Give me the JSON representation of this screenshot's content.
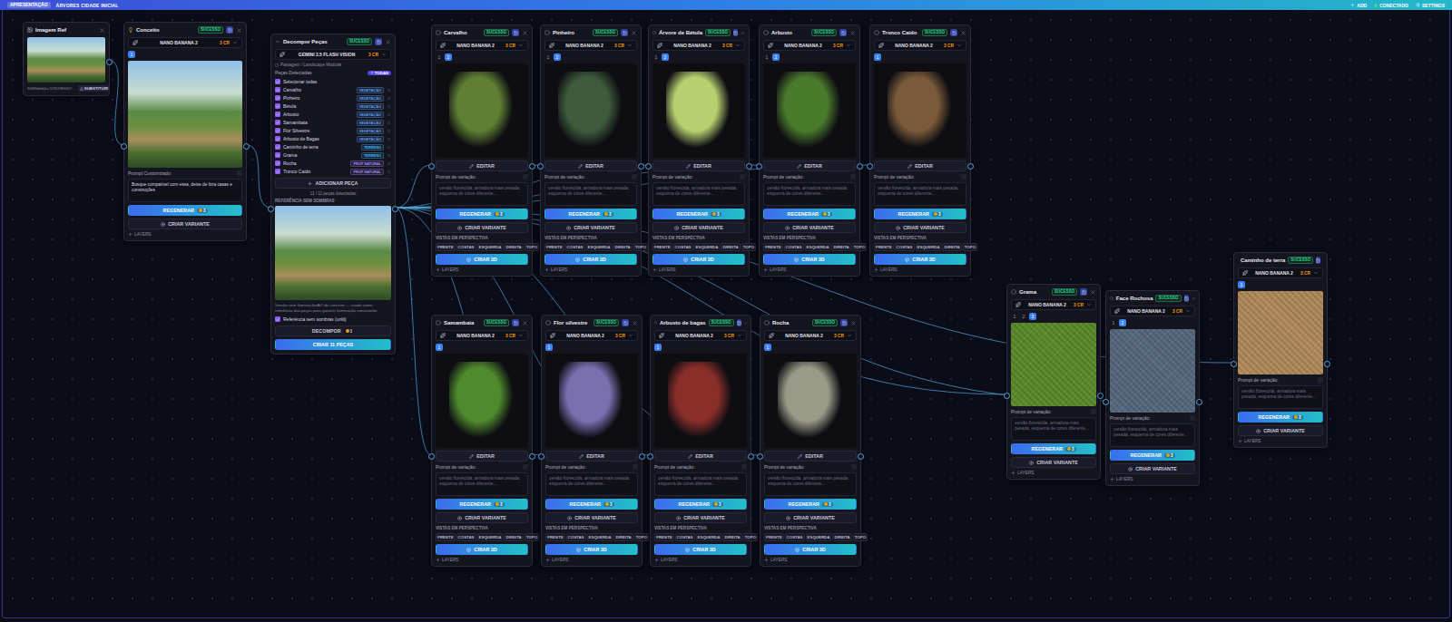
{
  "topbar": {
    "badge": "APRESENTAÇÃO",
    "title": "ÁRVORES CIDADE INICIAL",
    "actions": [
      "ADD",
      "CONECTADO",
      "SETTINGS"
    ]
  },
  "ref": {
    "title": "Imagem Ref",
    "filename": "5f498d0d4a-57f52f9f6f57...",
    "replace": "SUBSTITUIR"
  },
  "concept": {
    "title": "Conceito",
    "badge": "SUCESSO",
    "model": "NANO BANANA 2",
    "cost": "3 CR",
    "versions": [
      {
        "label": "1",
        "selected": true
      }
    ],
    "prompt_label": "Prompt Customizado:",
    "prompt": "Bosque compatível com essa, deixe de fora casas e construções",
    "regenerate": "REGENERAR",
    "regenerate_cost": "3",
    "variant": "CRIAR VARIANTE",
    "layers": "LAYERS"
  },
  "decompose": {
    "title": "Decompor Peças",
    "badge": "SUCESSO",
    "model": "GEMINI 2.5 FLASH VISION",
    "cost": "3 CR",
    "preset": "Paisagem / Landscape Modular",
    "detected_label": "Peças Detectadas",
    "all_button": "TODAS",
    "select_all": {
      "label": "Selecionar todas",
      "checked": true
    },
    "items": [
      {
        "name": "Carvalho",
        "tag": "VEGETAÇÃO",
        "color": "#60a5fa",
        "checked": true
      },
      {
        "name": "Pinheiro",
        "tag": "VEGETAÇÃO",
        "color": "#60a5fa",
        "checked": true
      },
      {
        "name": "Bétula",
        "tag": "VEGETAÇÃO",
        "color": "#60a5fa",
        "checked": true
      },
      {
        "name": "Arbusto",
        "tag": "VEGETAÇÃO",
        "color": "#60a5fa",
        "checked": true
      },
      {
        "name": "Samambaia",
        "tag": "VEGETAÇÃO",
        "color": "#60a5fa",
        "checked": true
      },
      {
        "name": "Flor Silvestre",
        "tag": "VEGETAÇÃO",
        "color": "#60a5fa",
        "checked": true
      },
      {
        "name": "Arbusto de Bagas",
        "tag": "VEGETAÇÃO",
        "color": "#60a5fa",
        "checked": true
      },
      {
        "name": "Caminho de terra",
        "tag": "TERRENO",
        "color": "#38bdf8",
        "checked": true
      },
      {
        "name": "Grama",
        "tag": "TERRENO",
        "color": "#38bdf8",
        "checked": true
      },
      {
        "name": "Rocha",
        "tag": "PROP NATURAL",
        "color": "#a78bfa",
        "checked": true
      },
      {
        "name": "Tronco Caído",
        "tag": "PROP NATURAL",
        "color": "#a78bfa",
        "checked": true
      }
    ],
    "add": "ADICIONAR PEÇA",
    "count": "11 / 11 peças detectadas",
    "reference_label": "REFERÊNCIA SEM SOMBRAS",
    "reference_note": "Versão sem iluminação/AO do conceito — usada como referência das peças para garantir iluminação consistente.",
    "unlit": {
      "label": "Referência sem sombras (unlit)",
      "checked": true
    },
    "decompose_button": "DECOMPOR",
    "decompose_cost": "3",
    "create_button": "CRIAR 11 PEÇAS"
  },
  "piece_ui": {
    "edit": "EDITAR",
    "prompt_label": "Prompt de variação:",
    "prompt_placeholder": "versão florescida, armadura mais pesada, esquema de cores diferente...",
    "regenerate": "REGENERAR",
    "regenerate_cost": "3",
    "variant": "CRIAR VARIANTE",
    "views_label": "VISTAS EM PERSPECTIVA",
    "views": [
      "FRENTE",
      "COSTAS",
      "ESQUERDA",
      "DIREITA",
      "TOPO"
    ],
    "create3d": "CRIAR 3D",
    "layers": "LAYERS"
  },
  "pieces": [
    {
      "title": "Carvalho",
      "badge": "SUCESSO",
      "model": "NANO BANANA 2",
      "cost": "3 CR",
      "color": "#5f7f34",
      "versions": [
        {
          "label": "1",
          "selected": false
        },
        {
          "label": "2",
          "selected": true
        }
      ]
    },
    {
      "title": "Pinheiro",
      "badge": "SUCESSO",
      "model": "NANO BANANA 2",
      "cost": "3 CR",
      "color": "#3e5c3c",
      "versions": [
        {
          "label": "1",
          "selected": false
        },
        {
          "label": "2",
          "selected": true
        }
      ]
    },
    {
      "title": "Árvore de Bétula",
      "badge": "SUCESSO",
      "model": "NANO BANANA 2",
      "cost": "3 CR",
      "color": "#b8d070",
      "versions": [
        {
          "label": "1",
          "selected": false
        },
        {
          "label": "2",
          "selected": true
        }
      ]
    },
    {
      "title": "Arbusto",
      "badge": "SUCESSO",
      "model": "NANO BANANA 2",
      "cost": "3 CR",
      "color": "#4a7a2c",
      "versions": [
        {
          "label": "1",
          "selected": false
        },
        {
          "label": "2",
          "selected": true
        }
      ]
    },
    {
      "title": "Tronco Caído",
      "badge": "SUCESSO",
      "model": "NANO BANANA 2",
      "cost": "3 CR",
      "color": "#7a5a3a",
      "versions": [
        {
          "label": "1",
          "selected": true
        }
      ]
    },
    {
      "title": "Samambaia",
      "badge": "SUCESSO",
      "model": "NANO BANANA 2",
      "cost": "3 CR",
      "color": "#4f8a2e",
      "versions": [
        {
          "label": "1",
          "selected": true
        }
      ]
    },
    {
      "title": "Flor silvestre",
      "badge": "SUCESSO",
      "model": "NANO BANANA 2",
      "cost": "3 CR",
      "color": "#7a70b0",
      "versions": [
        {
          "label": "1",
          "selected": true
        }
      ]
    },
    {
      "title": "Arbusto de bagas",
      "badge": "SUCESSO",
      "model": "NANO BANANA 2",
      "cost": "3 CR",
      "color": "#8a2e2a",
      "versions": [
        {
          "label": "1",
          "selected": true
        }
      ]
    },
    {
      "title": "Rocha",
      "badge": "SUCESSO",
      "model": "NANO BANANA 2",
      "cost": "3 CR",
      "color": "#9a9a88",
      "versions": [
        {
          "label": "1",
          "selected": true
        }
      ]
    }
  ],
  "textures": [
    {
      "title": "Grama",
      "badge": "SUCESSO",
      "model": "NANO BANANA 2",
      "cost": "3 CR",
      "color": "#5a8a2a",
      "versions": [
        {
          "label": "1",
          "selected": false
        },
        {
          "label": "2",
          "selected": false
        },
        {
          "label": "3",
          "selected": true
        }
      ]
    },
    {
      "title": "Face Rochosa",
      "badge": "SUCESSO",
      "model": "NANO BANANA 2",
      "cost": "3 CR",
      "color": "#56687e",
      "versions": [
        {
          "label": "1",
          "selected": false
        },
        {
          "label": "2",
          "selected": true
        }
      ]
    },
    {
      "title": "Caminho de terra",
      "badge": "SUCESSO",
      "model": "NANO BANANA 2",
      "cost": "3 CR",
      "color": "#b08a5a",
      "versions": [
        {
          "label": "1",
          "selected": true
        }
      ]
    }
  ]
}
